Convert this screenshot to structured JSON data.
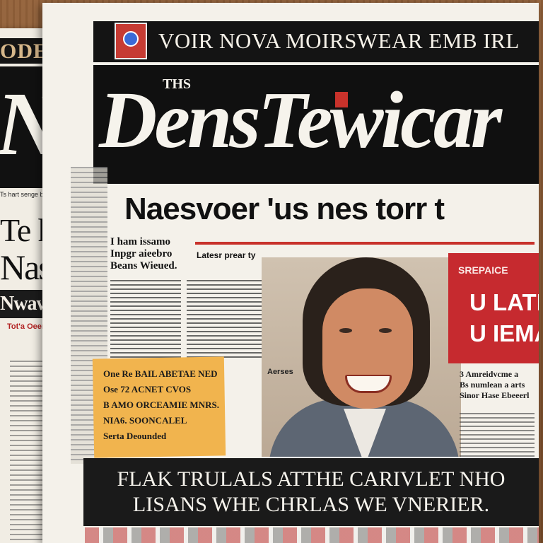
{
  "back_paper": {
    "top_text": "ODES NS",
    "masthead": "NaT",
    "sub_text": "Ts hart senge boti bu",
    "headline_line1": "Te ho",
    "headline_line2": "Nas",
    "bar_text": "Nwaw ar",
    "kicker": "Tot'a Oeerl"
  },
  "front_paper": {
    "kicker_text": "VOIR NOVA MOIRSWEAR EMB IRL",
    "masthead_the": "THS",
    "masthead": "DensTewicar",
    "headline": "Naesvoer 'us nes torr t",
    "story_title": [
      "I ham issamo",
      "Inpgr aieebro",
      "Beans Wieued."
    ],
    "subhead": "Latesr prear ty",
    "callout_lines": [
      "One Re BAIL ABETAE NED",
      "Ose 72 ACNET CVOS",
      "B AMO ORCEAMIE MNRS.",
      "NIA6. SOONCALEL",
      "Serta Deounded"
    ],
    "mini_tag": "Aerses",
    "red_panel": {
      "top": "SREPAICE",
      "line1": "U LATIA",
      "line2": "U IEMA"
    },
    "side_text": [
      "3 Amreidvcme a",
      "Bs numlean a arts",
      "Sinor Hase Ebeeerl"
    ],
    "banner_line1": "FLAK TRULALS ATTHE CARIVLET NHO",
    "banner_line2": "LISANS WHE CHRLAS WE VNERIER."
  }
}
